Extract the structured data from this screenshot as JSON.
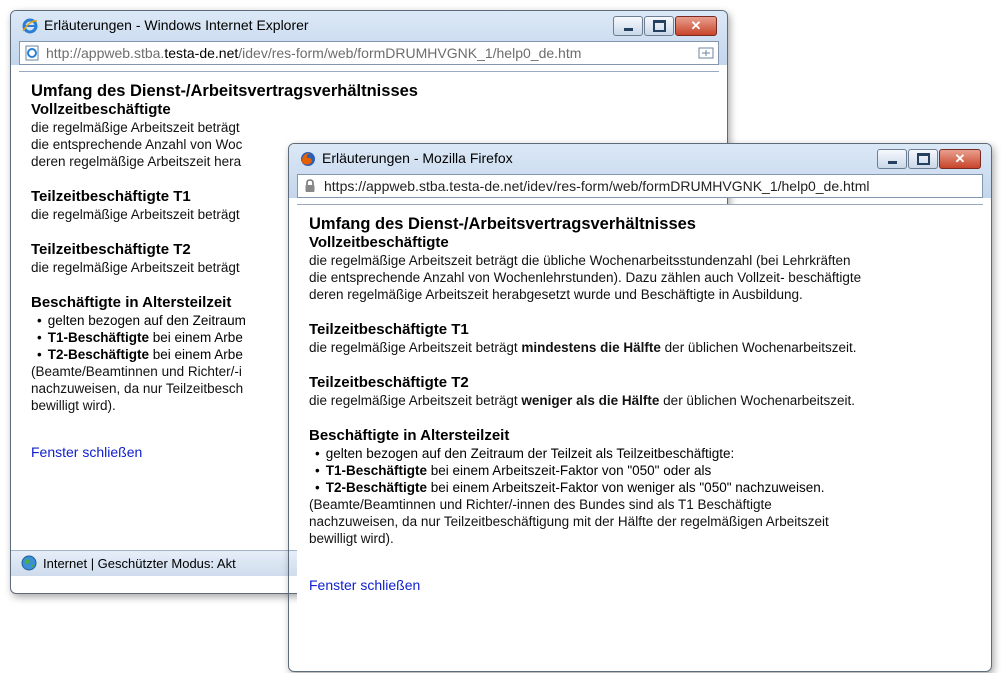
{
  "ie": {
    "title": "Erläuterungen - Windows Internet Explorer",
    "url_pre": "http://appweb.stba.",
    "url_domain": "testa-de.net",
    "url_post": "/idev/res-form/web/formDRUMHVGNK_1/help0_de.htm",
    "heading": "Umfang des Dienst-/Arbeitsvertragsverhältnisses",
    "s1_title": "Vollzeitbeschäftigte",
    "s1_l1": "die regelmäßige Arbeitszeit beträgt",
    "s1_l2": "die entsprechende Anzahl von Woc",
    "s1_l3": "deren regelmäßige Arbeitszeit hera",
    "s2_title": "Teilzeitbeschäftigte T1",
    "s2_l1": "die regelmäßige Arbeitszeit beträgt",
    "s3_title": "Teilzeitbeschäftigte T2",
    "s3_l1": "die regelmäßige Arbeitszeit beträgt",
    "s4_title": "Beschäftigte in Altersteilzeit",
    "b1": "gelten bezogen auf den Zeitraum",
    "b2_bold": "T1-Beschäftigte",
    "b2_rest": " bei einem Arbe",
    "b3_bold": "T2-Beschäftigte",
    "b3_rest": " bei einem Arbe",
    "n1": "(Beamte/Beamtinnen und Richter/-i",
    "n2": "nachzuweisen, da nur Teilzeitbesch",
    "n3": "bewilligt wird).",
    "close_link": "Fenster schließen",
    "status": "Internet | Geschützter Modus: Akt"
  },
  "ff": {
    "title": "Erläuterungen - Mozilla Firefox",
    "url": "https://appweb.stba.testa-de.net/idev/res-form/web/formDRUMHVGNK_1/help0_de.html",
    "heading": "Umfang des Dienst-/Arbeitsvertragsverhältnisses",
    "s1_title": "Vollzeitbeschäftigte",
    "s1_l1": "die regelmäßige Arbeitszeit beträgt die übliche Wochenarbeitsstundenzahl (bei Lehrkräften",
    "s1_l2": "die entsprechende Anzahl von Wochenlehrstunden). Dazu zählen auch Vollzeit- beschäftigte",
    "s1_l3": "deren regelmäßige Arbeitszeit herabgesetzt wurde und Beschäftigte in Ausbildung.",
    "s2_title": "Teilzeitbeschäftigte T1",
    "s2_pre": "die regelmäßige Arbeitszeit beträgt ",
    "s2_bold": "mindestens die Hälfte",
    "s2_post": " der üblichen Wochenarbeitszeit.",
    "s3_title": "Teilzeitbeschäftigte T2",
    "s3_pre": "die regelmäßige Arbeitszeit beträgt ",
    "s3_bold": "weniger als die Hälfte",
    "s3_post": " der üblichen Wochenarbeitszeit.",
    "s4_title": "Beschäftigte in Altersteilzeit",
    "b1": "gelten bezogen auf den Zeitraum der Teilzeit als Teilzeitbeschäftigte:",
    "b2_bold": "T1-Beschäftigte",
    "b2_rest": " bei einem Arbeitszeit-Faktor von \"050\" oder als",
    "b3_bold": "T2-Beschäftigte",
    "b3_rest": " bei einem Arbeitszeit-Faktor von weniger als \"050\" nachzuweisen.",
    "n1": "(Beamte/Beamtinnen und Richter/-innen des Bundes sind als T1 Beschäftigte",
    "n2": "nachzuweisen, da nur Teilzeitbeschäftigung mit der Hälfte der regelmäßigen Arbeitszeit",
    "n3": "bewilligt wird).",
    "close_link": "Fenster schließen"
  }
}
